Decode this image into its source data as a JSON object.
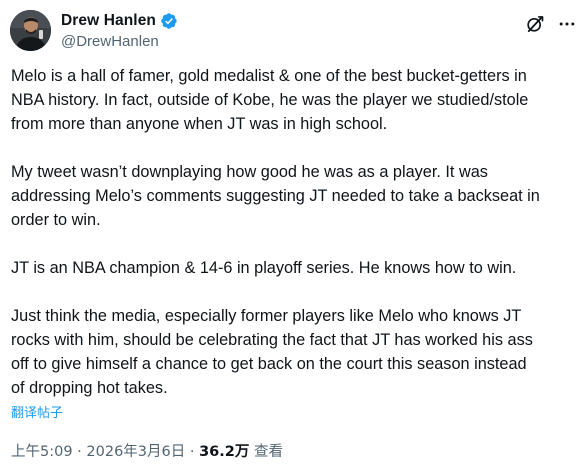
{
  "author": {
    "display_name": "Drew Hanlen",
    "handle": "@DrewHanlen",
    "verified": true,
    "verified_color": "#1d9bf0"
  },
  "icons": {
    "grok": "grok-icon",
    "more": "more-horizontal-icon",
    "verified": "verified-badge-icon"
  },
  "tweet": {
    "paragraphs": [
      {
        "lines": [
          "Melo is a hall of famer, gold medalist & one of the best bucket-getters in",
          "NBA history. In fact, outside of Kobe, he was the player we studied/stole",
          "from more than anyone when JT was in high school."
        ]
      },
      {
        "lines": [
          "My tweet wasn’t downplaying how good he was as a player. It was",
          "addressing Melo’s comments suggesting JT needed to take a backseat in",
          "order to win."
        ]
      },
      {
        "lines": [
          "JT is an NBA champion & 14-6 in playoff series. He knows how to win."
        ]
      },
      {
        "lines": [
          "Just think the media, especially former players like Melo who knows JT",
          "rocks with him, should be celebrating the fact that JT has worked his ass",
          "off to give himself a chance to get back on the court this season instead",
          "of dropping hot takes."
        ]
      }
    ],
    "translate_label": "翻译帖子"
  },
  "meta": {
    "time": "上午5:09",
    "separator": " · ",
    "date": "2026年3月6日",
    "views": "36.2万",
    "views_label": " 查看"
  },
  "colors": {
    "text": "#0f1419",
    "secondary": "#536471",
    "link": "#1d9bf0"
  }
}
